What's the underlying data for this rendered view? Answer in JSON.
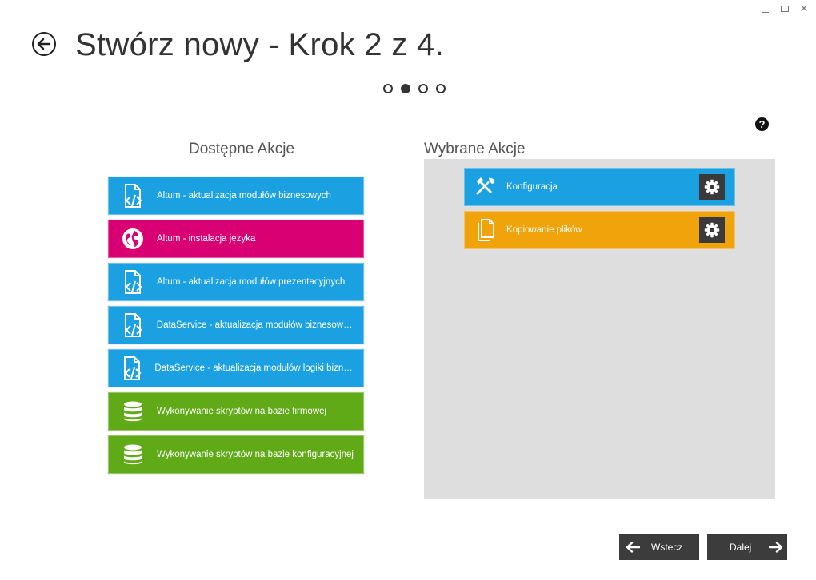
{
  "window": {
    "close_glyph": "✕"
  },
  "header": {
    "title": "Stwórz nowy - Krok 2 z 4."
  },
  "steps": {
    "total": 4,
    "current": 2
  },
  "help": {
    "glyph": "?"
  },
  "available": {
    "title": "Dostępne Akcje",
    "items": [
      {
        "label": "Altum - aktualizacja modułów biznesowych",
        "color": "#1ba1e2",
        "icon": "code-file-icon"
      },
      {
        "label": "Altum - instalacja języka",
        "color": "#d80073",
        "icon": "globe-icon"
      },
      {
        "label": "Altum - aktualizacja modułów prezentacyjnych",
        "color": "#1ba1e2",
        "icon": "code-file-icon"
      },
      {
        "label": "DataService - aktualizacja modułów biznesowych",
        "color": "#1ba1e2",
        "icon": "code-file-icon"
      },
      {
        "label": "DataService - aktualizacja modułów logiki bizneso...",
        "color": "#1ba1e2",
        "icon": "code-file-icon"
      },
      {
        "label": "Wykonywanie skryptów na bazie firmowej",
        "color": "#60a917",
        "icon": "database-icon"
      },
      {
        "label": "Wykonywanie skryptów na bazie konfiguracyjnej",
        "color": "#60a917",
        "icon": "database-icon"
      }
    ]
  },
  "selected": {
    "title": "Wybrane Akcje",
    "items": [
      {
        "label": "Konfiguracja",
        "color": "#1ba1e2",
        "icon": "tools-icon"
      },
      {
        "label": "Kopiowanie plików",
        "color": "#f0a30a",
        "icon": "copy-files-icon"
      }
    ]
  },
  "nav": {
    "back_label": "Wstecz",
    "next_label": "Dalej"
  }
}
